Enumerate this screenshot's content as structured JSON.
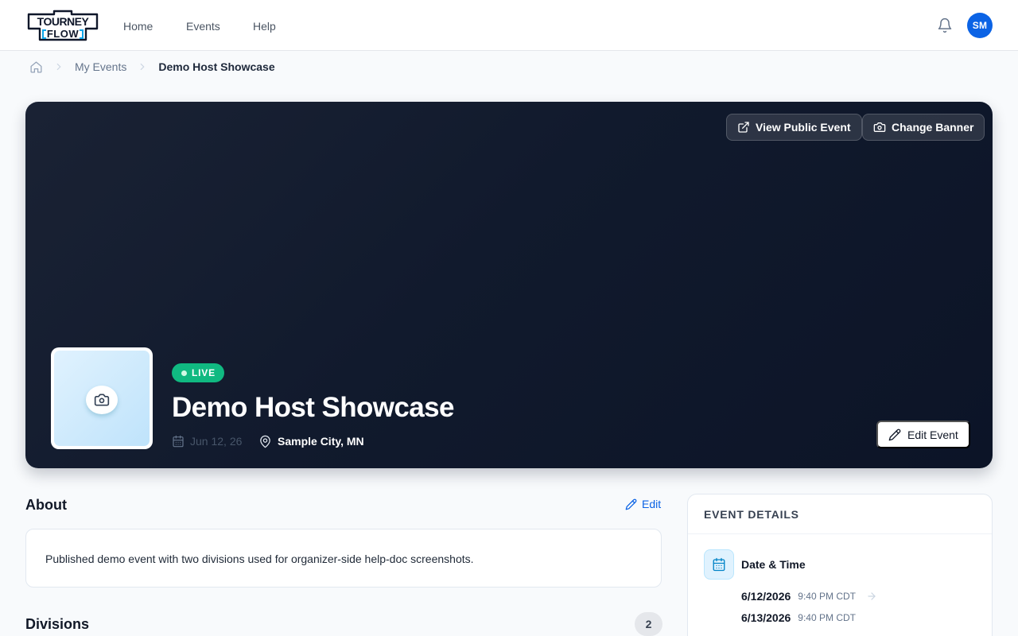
{
  "nav": {
    "logo_text_top": "TOURNEY",
    "logo_text_bottom": "FLOW",
    "links": [
      "Home",
      "Events",
      "Help"
    ],
    "avatar_initials": "SM"
  },
  "breadcrumb": {
    "items": [
      "My Events"
    ],
    "current": "Demo Host Showcase"
  },
  "hero": {
    "view_public_label": "View Public Event",
    "change_banner_label": "Change Banner",
    "status": "LIVE",
    "title": "Demo Host Showcase",
    "date": "Jun 12, 26",
    "location": "Sample City, MN",
    "edit_event_label": "Edit Event"
  },
  "about": {
    "heading": "About",
    "edit_label": "Edit",
    "description": "Published demo event with two divisions used for organizer-side help-doc screenshots."
  },
  "divisions": {
    "heading": "Divisions",
    "count": "2"
  },
  "event_details": {
    "heading": "EVENT DETAILS",
    "date_time_label": "Date & Time",
    "start_date": "6/12/2026",
    "start_time": "9:40 PM CDT",
    "end_date": "6/13/2026",
    "end_time": "9:40 PM CDT"
  },
  "colors": {
    "accent": "#0b63e5",
    "live": "#10b981",
    "hero_bg": "#111a2d"
  },
  "icons": [
    "bell-icon",
    "home-icon",
    "chevron-right-icon",
    "external-link-icon",
    "camera-icon",
    "calendar-icon",
    "map-pin-icon",
    "pencil-icon",
    "arrow-right-icon"
  ]
}
